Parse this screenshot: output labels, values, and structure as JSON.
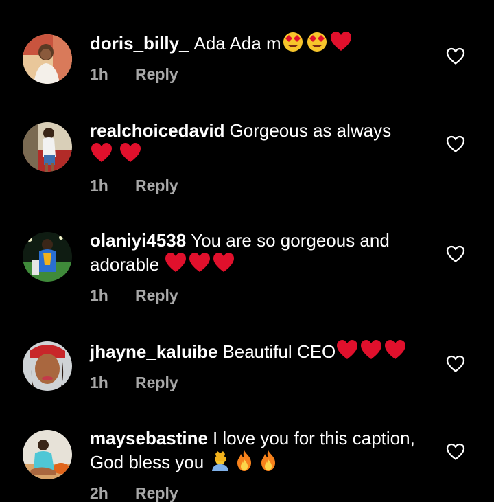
{
  "comments": [
    {
      "username": "doris_billy_",
      "text": "Ada Ada m",
      "emojis": [
        "heart-eyes",
        "heart-eyes",
        "red-heart"
      ],
      "time": "1h",
      "reply_label": "Reply",
      "avatar_icon": "avatar-photo"
    },
    {
      "username": "realchoicedavid",
      "text": "Gorgeous as always",
      "emojis": [
        "red-heart",
        "red-heart"
      ],
      "time": "1h",
      "reply_label": "Reply",
      "avatar_icon": "avatar-photo"
    },
    {
      "username": "olaniyi4538",
      "text": "You are so gorgeous and adorable",
      "emojis": [
        "red-heart",
        "red-heart",
        "red-heart"
      ],
      "time": "1h",
      "reply_label": "Reply",
      "avatar_icon": "avatar-photo"
    },
    {
      "username": "jhayne_kaluibe",
      "text": "Beautiful CEO",
      "emojis": [
        "red-heart",
        "red-heart",
        "red-heart"
      ],
      "time": "1h",
      "reply_label": "Reply",
      "avatar_icon": "avatar-photo"
    },
    {
      "username": "maysebastine",
      "text": "I love you for this caption, God bless you",
      "emojis": [
        "person-with-crown",
        "fire",
        "fire"
      ],
      "time": "2h",
      "reply_label": "Reply",
      "avatar_icon": "avatar-photo"
    }
  ],
  "like_icon": "heart-outline-icon",
  "colors": {
    "background": "#000000",
    "text": "#ffffff",
    "meta": "#a8a8a8",
    "heart": "#e0102c"
  }
}
